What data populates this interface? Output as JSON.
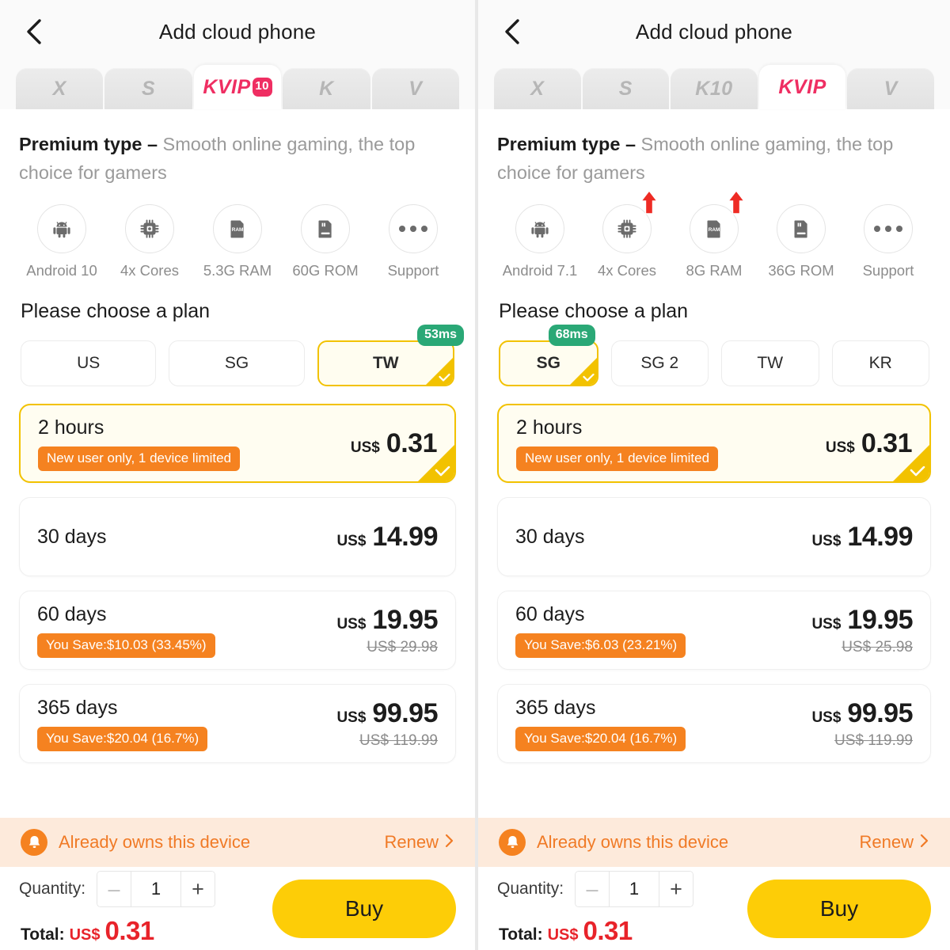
{
  "panels": [
    {
      "header": {
        "title": "Add cloud phone",
        "back_icon": "chevron-left-icon"
      },
      "tabs": [
        {
          "label": "X",
          "active": false,
          "badge": null
        },
        {
          "label": "S",
          "active": false,
          "badge": null
        },
        {
          "label": "KVIP",
          "active": true,
          "badge": "10"
        },
        {
          "label": "K",
          "active": false,
          "badge": null
        },
        {
          "label": "V",
          "active": false,
          "badge": null
        }
      ],
      "premium": {
        "strong": "Premium type –",
        "desc": "Smooth online gaming, the top choice for gamers"
      },
      "specs": [
        {
          "icon": "android-icon",
          "label": "Android 10",
          "arrow": false
        },
        {
          "icon": "cpu-icon",
          "label": "4x Cores",
          "arrow": false
        },
        {
          "icon": "ram-icon",
          "label": "5.3G RAM",
          "arrow": false
        },
        {
          "icon": "rom-icon",
          "label": "60G ROM",
          "arrow": false
        },
        {
          "icon": "more-icon",
          "label": "Support",
          "arrow": false
        }
      ],
      "choose_title": "Please choose a plan",
      "regions": [
        {
          "label": "US",
          "selected": false,
          "latency": null
        },
        {
          "label": "SG",
          "selected": false,
          "latency": null
        },
        {
          "label": "TW",
          "selected": true,
          "latency": "53ms"
        }
      ],
      "plans": [
        {
          "title": "2 hours",
          "tag": "New user only, 1 device limited",
          "currency": "US$",
          "price": "0.31",
          "old_price": null,
          "selected": true
        },
        {
          "title": "30 days",
          "tag": null,
          "currency": "US$",
          "price": "14.99",
          "old_price": null,
          "selected": false
        },
        {
          "title": "60 days",
          "tag": "You Save:$10.03 (33.45%)",
          "currency": "US$",
          "price": "19.95",
          "old_price": "US$ 29.98",
          "selected": false
        },
        {
          "title": "365 days",
          "tag": "You Save:$20.04 (16.7%)",
          "currency": "US$",
          "price": "99.95",
          "old_price": "US$ 119.99",
          "selected": false
        }
      ],
      "owned_banner": {
        "icon": "bell-icon",
        "text": "Already owns this device",
        "action": "Renew",
        "action_icon": "chevron-right-icon"
      },
      "bottom": {
        "quantity_label": "Quantity:",
        "quantity_value": "1",
        "minus_label": "–",
        "plus_label": "+",
        "total_label": "Total:",
        "total_currency": "US$",
        "total_amount": "0.31",
        "buy_label": "Buy"
      }
    },
    {
      "header": {
        "title": "Add cloud phone",
        "back_icon": "chevron-left-icon"
      },
      "tabs": [
        {
          "label": "X",
          "active": false,
          "badge": null
        },
        {
          "label": "S",
          "active": false,
          "badge": null
        },
        {
          "label": "K10",
          "active": false,
          "badge": null
        },
        {
          "label": "KVIP",
          "active": true,
          "badge": null
        },
        {
          "label": "V",
          "active": false,
          "badge": null
        }
      ],
      "premium": {
        "strong": "Premium type –",
        "desc": "Smooth online gaming, the top choice for gamers"
      },
      "specs": [
        {
          "icon": "android-icon",
          "label": "Android 7.1",
          "arrow": false
        },
        {
          "icon": "cpu-icon",
          "label": "4x Cores",
          "arrow": true
        },
        {
          "icon": "ram-icon",
          "label": "8G RAM",
          "arrow": true
        },
        {
          "icon": "rom-icon",
          "label": "36G ROM",
          "arrow": false
        },
        {
          "icon": "more-icon",
          "label": "Support",
          "arrow": false
        }
      ],
      "choose_title": "Please choose a plan",
      "regions": [
        {
          "label": "SG",
          "selected": true,
          "latency": "68ms"
        },
        {
          "label": "SG 2",
          "selected": false,
          "latency": null
        },
        {
          "label": "TW",
          "selected": false,
          "latency": null
        },
        {
          "label": "KR",
          "selected": false,
          "latency": null
        }
      ],
      "plans": [
        {
          "title": "2 hours",
          "tag": "New user only, 1 device limited",
          "currency": "US$",
          "price": "0.31",
          "old_price": null,
          "selected": true
        },
        {
          "title": "30 days",
          "tag": null,
          "currency": "US$",
          "price": "14.99",
          "old_price": null,
          "selected": false
        },
        {
          "title": "60 days",
          "tag": "You Save:$6.03 (23.21%)",
          "currency": "US$",
          "price": "19.95",
          "old_price": "US$ 25.98",
          "selected": false
        },
        {
          "title": "365 days",
          "tag": "You Save:$20.04 (16.7%)",
          "currency": "US$",
          "price": "99.95",
          "old_price": "US$ 119.99",
          "selected": false
        }
      ],
      "owned_banner": {
        "icon": "bell-icon",
        "text": "Already owns this device",
        "action": "Renew",
        "action_icon": "chevron-right-icon"
      },
      "bottom": {
        "quantity_label": "Quantity:",
        "quantity_value": "1",
        "minus_label": "–",
        "plus_label": "+",
        "total_label": "Total:",
        "total_currency": "US$",
        "total_amount": "0.31",
        "buy_label": "Buy"
      }
    }
  ],
  "colors": {
    "accent_pink": "#ef2e62",
    "select_yellow": "#f2c200",
    "buy_yellow": "#fdcd07",
    "tag_orange": "#f58220",
    "latency_green": "#2aa876",
    "total_red": "#e8232a",
    "banner_bg": "#fdeadb"
  }
}
